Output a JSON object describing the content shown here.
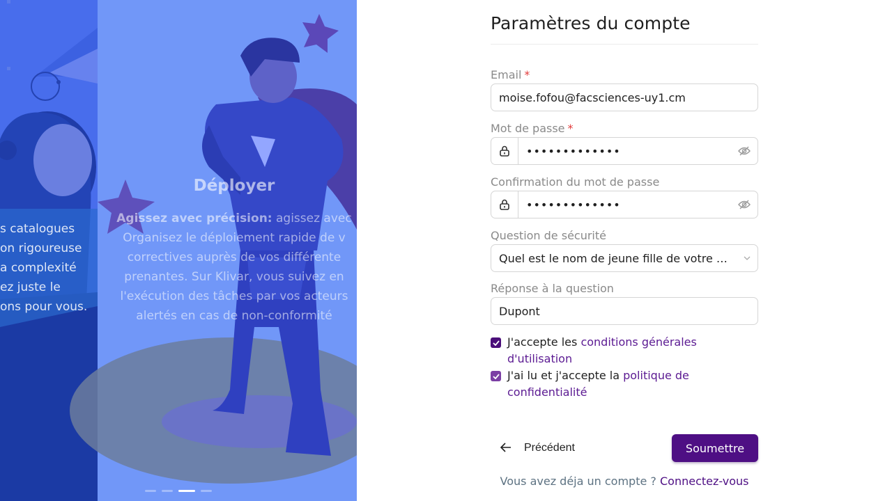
{
  "carousel": {
    "prev_slide_lines": [
      "s catalogues",
      "on rigoureuse",
      "a complexité",
      "ez juste le",
      "ons pour vous."
    ],
    "current_title": "Déployer",
    "current_lead": "Agissez avec précision:",
    "current_body_lines": [
      "agissez avec",
      "Organisez le déploiement rapide de v",
      "correctives auprès de vos différente",
      "prenantes. Sur Klivar, vous suivez en",
      "l'exécution des tâches par vos acteurs",
      "alertés en cas de non-conformité"
    ],
    "dots": [
      false,
      false,
      true,
      false
    ]
  },
  "form": {
    "title": "Paramètres du compte",
    "email": {
      "label": "Email",
      "required": "*",
      "value": "moise.fofou@facsciences-uy1.cm"
    },
    "password": {
      "label": "Mot de passe",
      "required": "*",
      "value": "•••••••••••••"
    },
    "confirm": {
      "label": "Confirmation du mot de passe",
      "value": "•••••••••••••"
    },
    "question": {
      "label": "Question de sécurité",
      "value": "Quel est le nom de jeune fille de votre mère ?"
    },
    "answer": {
      "label": "Réponse à la question",
      "value": "Dupont"
    },
    "terms": {
      "prefix": "J'accepte les ",
      "link": "conditions générales d'utilisation",
      "checked": true
    },
    "privacy": {
      "prefix": "J'ai lu et j'accepte la ",
      "link": "politique de confidentialité",
      "checked": true
    },
    "back_label": "Précédent",
    "submit_label": "Soumettre",
    "footer_prefix": "Vous avez déja un compte ? ",
    "footer_link": "Connectez-vous"
  },
  "colors": {
    "accent": "#4e0f84",
    "panel": "#7197f8",
    "required": "#e23b3b"
  }
}
